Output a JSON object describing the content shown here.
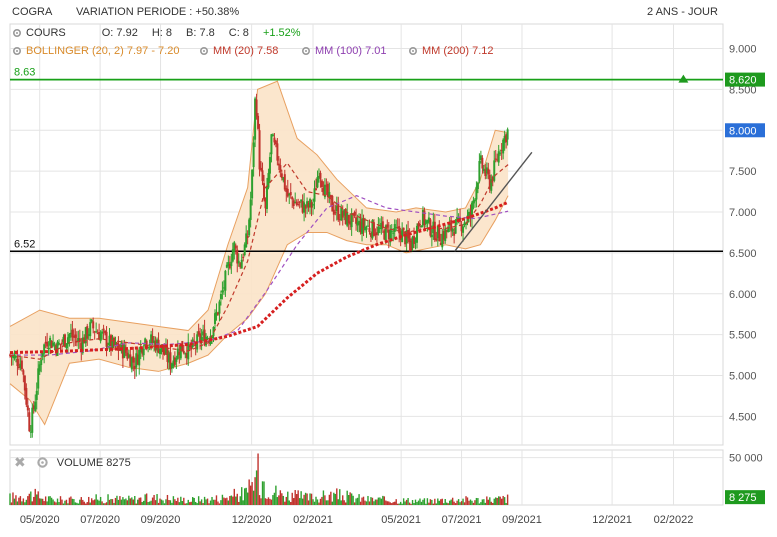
{
  "header": {
    "ticker": "COGRA",
    "variation": "VARIATION PERIODE : +50.38%",
    "period": "2 ANS - JOUR"
  },
  "legend": {
    "cours_label": "COURS",
    "open": "O: 7.92",
    "high": "H: 8",
    "low": "B: 7.8",
    "close": "C: 8",
    "change": "+1.52%",
    "bollinger": "BOLLINGER (20, 2) 7.97 - 7.20",
    "mm20": "MM (20) 7.58",
    "mm100": "MM (100) 7.01",
    "mm200": "MM (200) 7.12"
  },
  "volume_panel": {
    "label": "VOLUME 8275"
  },
  "colors": {
    "up": "#2ea02e",
    "down": "#c0322c",
    "bollinger_fill": "#fbe3c8",
    "bollinger_line": "#e8a060",
    "mm20": "#c0392b",
    "mm100": "#a050c0",
    "mm200": "#d62020",
    "green_line": "#18a018",
    "last_price": "#2a6fd8"
  },
  "chart_data": [
    {
      "type": "candlestick",
      "title": "",
      "ylim": [
        4.15,
        9.3
      ],
      "y_ticks": [
        "9.000",
        "8.500",
        "8.000",
        "7.500",
        "7.000",
        "6.500",
        "6.000",
        "5.500",
        "5.000",
        "4.500"
      ],
      "y_tick_values": [
        9.0,
        8.5,
        8.0,
        7.5,
        7.0,
        6.5,
        6.0,
        5.5,
        5.0,
        4.5
      ],
      "x_ticks": [
        "05/2020",
        "07/2020",
        "09/2020",
        "12/2020",
        "02/2021",
        "05/2021",
        "07/2021",
        "09/2021",
        "12/2021",
        "02/2022"
      ],
      "x_tick_days": [
        30,
        91,
        152,
        244,
        306,
        395,
        456,
        517,
        608,
        670
      ],
      "x_range_days": [
        0,
        720
      ],
      "horizontal_lines": [
        {
          "label": "8.63",
          "value": 8.62,
          "tag": "8.620",
          "color": "#18a018"
        },
        {
          "label": "6.52",
          "value": 6.52,
          "color": "#000000"
        }
      ],
      "last_price": {
        "value": 8.0,
        "tag": "8.000"
      },
      "trendline": [
        {
          "day": 449,
          "price": 6.52
        },
        {
          "day": 527,
          "price": 7.73
        }
      ],
      "price_path": [
        [
          0,
          5.25
        ],
        [
          12,
          5.15
        ],
        [
          20,
          4.35
        ],
        [
          24,
          4.6
        ],
        [
          32,
          5.3
        ],
        [
          38,
          5.45
        ],
        [
          48,
          5.35
        ],
        [
          60,
          5.5
        ],
        [
          72,
          5.4
        ],
        [
          82,
          5.6
        ],
        [
          92,
          5.5
        ],
        [
          104,
          5.35
        ],
        [
          116,
          5.3
        ],
        [
          126,
          5.15
        ],
        [
          136,
          5.45
        ],
        [
          146,
          5.4
        ],
        [
          152,
          5.35
        ],
        [
          162,
          5.15
        ],
        [
          172,
          5.35
        ],
        [
          182,
          5.3
        ],
        [
          192,
          5.45
        ],
        [
          202,
          5.5
        ],
        [
          210,
          5.8
        ],
        [
          218,
          6.2
        ],
        [
          226,
          6.6
        ],
        [
          232,
          6.35
        ],
        [
          240,
          6.7
        ],
        [
          244,
          7.3
        ],
        [
          248,
          8.5
        ],
        [
          252,
          7.6
        ],
        [
          258,
          7.0
        ],
        [
          264,
          7.9
        ],
        [
          272,
          7.6
        ],
        [
          280,
          7.2
        ],
        [
          290,
          7.1
        ],
        [
          300,
          7.05
        ],
        [
          306,
          7.1
        ],
        [
          312,
          7.55
        ],
        [
          318,
          7.25
        ],
        [
          326,
          7.05
        ],
        [
          336,
          6.95
        ],
        [
          350,
          6.85
        ],
        [
          365,
          6.8
        ],
        [
          380,
          6.75
        ],
        [
          395,
          6.75
        ],
        [
          405,
          6.6
        ],
        [
          415,
          6.95
        ],
        [
          425,
          6.8
        ],
        [
          435,
          6.7
        ],
        [
          445,
          6.8
        ],
        [
          455,
          6.85
        ],
        [
          465,
          6.95
        ],
        [
          475,
          7.6
        ],
        [
          485,
          7.35
        ],
        [
          495,
          7.8
        ],
        [
          503,
          8.0
        ]
      ],
      "mm20": [
        [
          0,
          5.25
        ],
        [
          30,
          5.2
        ],
        [
          60,
          5.4
        ],
        [
          90,
          5.45
        ],
        [
          120,
          5.4
        ],
        [
          150,
          5.35
        ],
        [
          180,
          5.3
        ],
        [
          200,
          5.4
        ],
        [
          220,
          5.85
        ],
        [
          240,
          6.4
        ],
        [
          258,
          7.3
        ],
        [
          280,
          7.6
        ],
        [
          300,
          7.25
        ],
        [
          320,
          7.2
        ],
        [
          340,
          7.0
        ],
        [
          360,
          6.9
        ],
        [
          380,
          6.8
        ],
        [
          400,
          6.75
        ],
        [
          420,
          6.8
        ],
        [
          440,
          6.8
        ],
        [
          460,
          6.85
        ],
        [
          475,
          7.1
        ],
        [
          490,
          7.45
        ],
        [
          503,
          7.58
        ]
      ],
      "mm100": [
        [
          0,
          5.25
        ],
        [
          40,
          5.25
        ],
        [
          80,
          5.3
        ],
        [
          120,
          5.4
        ],
        [
          160,
          5.38
        ],
        [
          200,
          5.42
        ],
        [
          230,
          5.55
        ],
        [
          260,
          6.05
        ],
        [
          290,
          6.6
        ],
        [
          320,
          7.05
        ],
        [
          350,
          7.2
        ],
        [
          380,
          7.05
        ],
        [
          410,
          7.0
        ],
        [
          440,
          6.95
        ],
        [
          470,
          6.92
        ],
        [
          503,
          7.01
        ]
      ],
      "mm200": [
        [
          0,
          5.28
        ],
        [
          60,
          5.3
        ],
        [
          120,
          5.33
        ],
        [
          180,
          5.38
        ],
        [
          220,
          5.48
        ],
        [
          250,
          5.6
        ],
        [
          280,
          5.95
        ],
        [
          310,
          6.25
        ],
        [
          340,
          6.45
        ],
        [
          370,
          6.6
        ],
        [
          400,
          6.72
        ],
        [
          430,
          6.82
        ],
        [
          460,
          6.92
        ],
        [
          490,
          7.05
        ],
        [
          503,
          7.12
        ]
      ],
      "bollinger_upper": [
        [
          0,
          5.6
        ],
        [
          30,
          5.8
        ],
        [
          60,
          5.7
        ],
        [
          90,
          5.7
        ],
        [
          120,
          5.65
        ],
        [
          150,
          5.6
        ],
        [
          180,
          5.55
        ],
        [
          200,
          5.8
        ],
        [
          220,
          6.6
        ],
        [
          240,
          7.3
        ],
        [
          250,
          8.5
        ],
        [
          270,
          8.6
        ],
        [
          290,
          7.9
        ],
        [
          310,
          7.7
        ],
        [
          330,
          7.4
        ],
        [
          360,
          7.05
        ],
        [
          390,
          7.0
        ],
        [
          410,
          7.05
        ],
        [
          440,
          7.0
        ],
        [
          460,
          7.05
        ],
        [
          475,
          7.4
        ],
        [
          490,
          8.0
        ],
        [
          503,
          7.97
        ]
      ],
      "bollinger_lower": [
        [
          0,
          4.9
        ],
        [
          20,
          4.7
        ],
        [
          35,
          4.4
        ],
        [
          60,
          5.15
        ],
        [
          90,
          5.2
        ],
        [
          120,
          5.1
        ],
        [
          150,
          5.05
        ],
        [
          180,
          5.15
        ],
        [
          200,
          5.25
        ],
        [
          220,
          5.5
        ],
        [
          240,
          5.7
        ],
        [
          258,
          6.0
        ],
        [
          280,
          6.6
        ],
        [
          300,
          6.75
        ],
        [
          320,
          6.75
        ],
        [
          340,
          6.65
        ],
        [
          360,
          6.6
        ],
        [
          380,
          6.6
        ],
        [
          400,
          6.5
        ],
        [
          420,
          6.55
        ],
        [
          440,
          6.6
        ],
        [
          460,
          6.55
        ],
        [
          475,
          6.6
        ],
        [
          490,
          6.9
        ],
        [
          503,
          7.2
        ]
      ]
    },
    {
      "type": "bar",
      "title": "",
      "y_ticks": [
        "50 000"
      ],
      "y_tick_values": [
        50000
      ],
      "ylim": [
        0,
        58000
      ],
      "last_volume": {
        "value": 8275,
        "tag": "8 275"
      },
      "volume_profile": [
        [
          0,
          9000
        ],
        [
          20,
          13000
        ],
        [
          40,
          7000
        ],
        [
          60,
          6000
        ],
        [
          90,
          8000
        ],
        [
          120,
          7000
        ],
        [
          150,
          9000
        ],
        [
          180,
          6000
        ],
        [
          210,
          8000
        ],
        [
          240,
          15000
        ],
        [
          250,
          38000
        ],
        [
          270,
          14000
        ],
        [
          300,
          9000
        ],
        [
          330,
          12000
        ],
        [
          360,
          7000
        ],
        [
          390,
          6000
        ],
        [
          420,
          5000
        ],
        [
          450,
          7000
        ],
        [
          480,
          6000
        ],
        [
          503,
          8275
        ]
      ]
    }
  ]
}
